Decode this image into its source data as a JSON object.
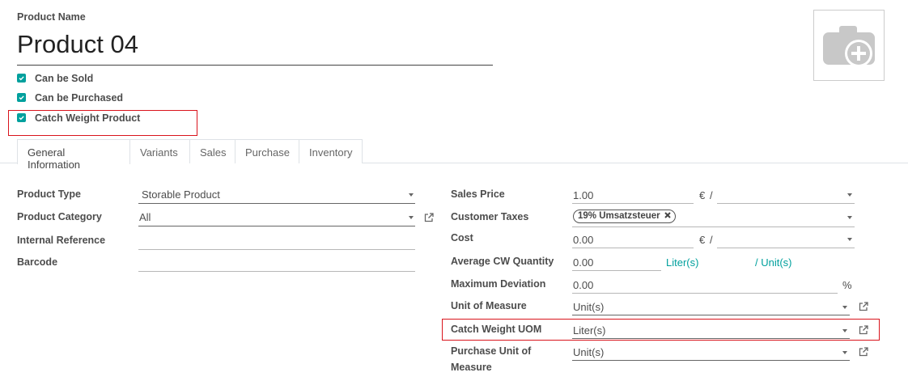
{
  "product": {
    "name_label": "Product Name",
    "name": "Product 04"
  },
  "checkboxes": [
    {
      "label": "Can be Sold",
      "checked": true
    },
    {
      "label": "Can be Purchased",
      "checked": true
    },
    {
      "label": "Catch Weight Product",
      "checked": true
    }
  ],
  "tabs": [
    {
      "label": "General Information",
      "active": true
    },
    {
      "label": "Variants"
    },
    {
      "label": "Sales"
    },
    {
      "label": "Purchase"
    },
    {
      "label": "Inventory"
    }
  ],
  "left": {
    "product_type": {
      "label": "Product Type",
      "value": "Storable Product"
    },
    "product_category": {
      "label": "Product Category",
      "value": "All"
    },
    "internal_reference": {
      "label": "Internal Reference",
      "value": ""
    },
    "barcode": {
      "label": "Barcode",
      "value": ""
    }
  },
  "right": {
    "sales_price": {
      "label": "Sales Price",
      "value": "1.00",
      "currency": "€",
      "slash": "/"
    },
    "customer_taxes": {
      "label": "Customer Taxes",
      "tag": "19% Umsatzsteuer"
    },
    "cost": {
      "label": "Cost",
      "value": "0.00",
      "currency": "€",
      "slash": "/"
    },
    "avg_cw_qty": {
      "label": "Average CW Quantity",
      "value": "0.00",
      "unit1": "Liter(s)",
      "unit2": "/ Unit(s)"
    },
    "max_deviation": {
      "label": "Maximum Deviation",
      "value": "0.00",
      "suffix": "%"
    },
    "uom": {
      "label": "Unit of Measure",
      "value": "Unit(s)"
    },
    "cw_uom": {
      "label": "Catch Weight UOM",
      "value": "Liter(s)"
    },
    "purchase_uom": {
      "label_line1": "Purchase Unit of",
      "label_line2": "Measure",
      "value": "Unit(s)"
    }
  },
  "colors": {
    "accent": "#00a09d",
    "highlight": "#d9141c"
  },
  "icons": {
    "image_placeholder": "camera-plus-icon",
    "external": "external-link-icon"
  }
}
